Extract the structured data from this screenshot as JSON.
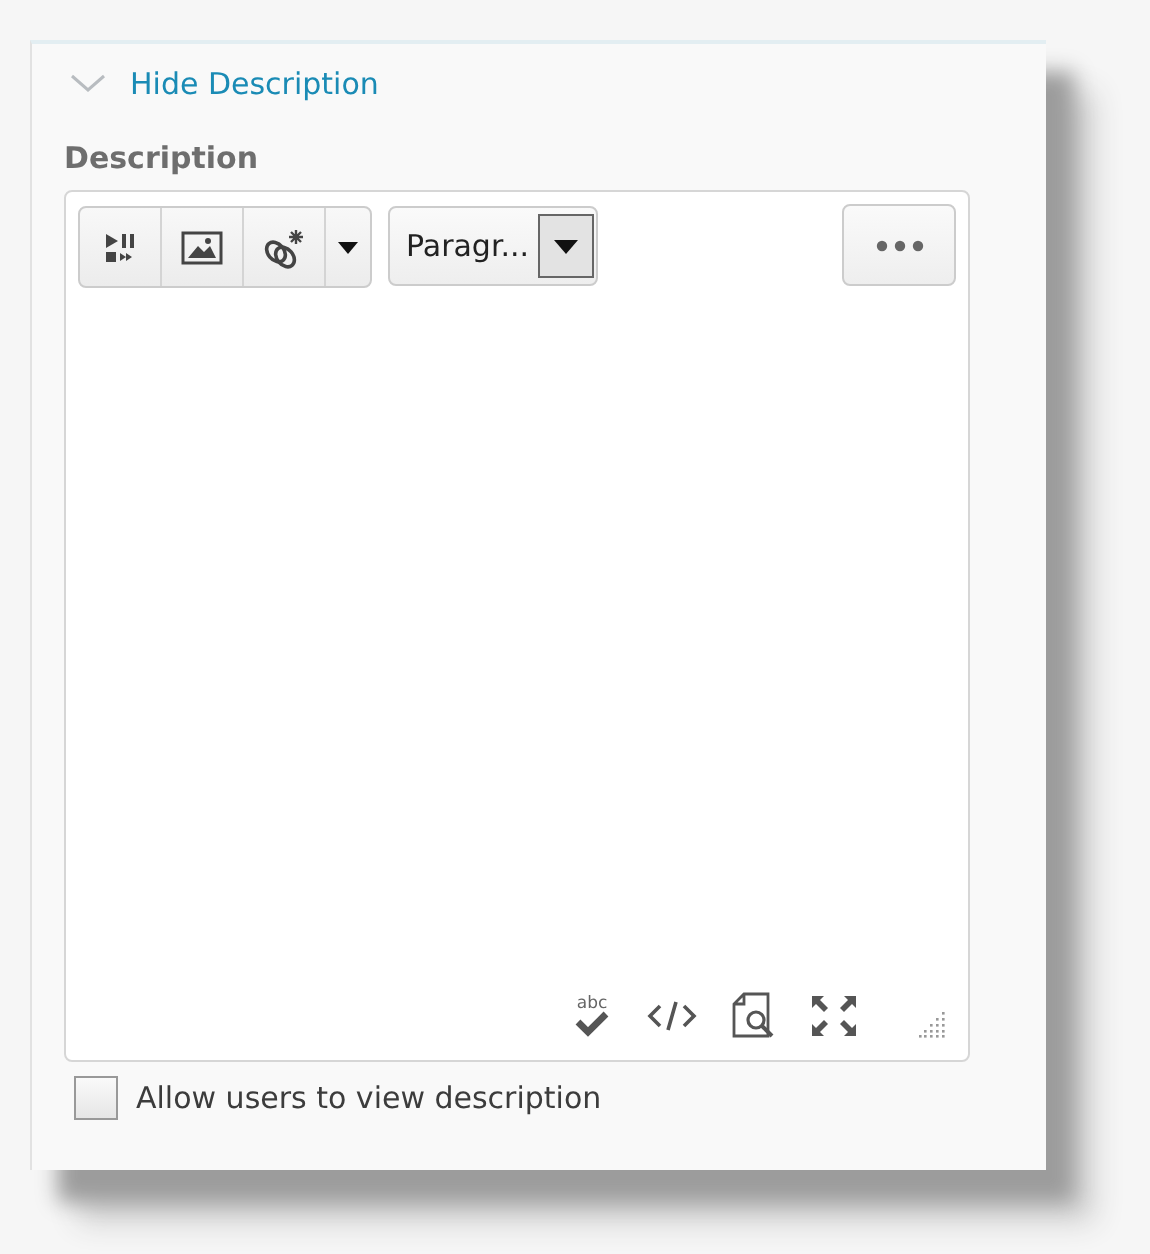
{
  "toggle": {
    "label": "Hide Description",
    "expanded": true
  },
  "field_label": "Description",
  "toolbar": {
    "format_select": "Paragr..."
  },
  "status_icons": {
    "spellcheck_text": "abc"
  },
  "checkbox": {
    "label": "Allow users to view description",
    "checked": false
  }
}
